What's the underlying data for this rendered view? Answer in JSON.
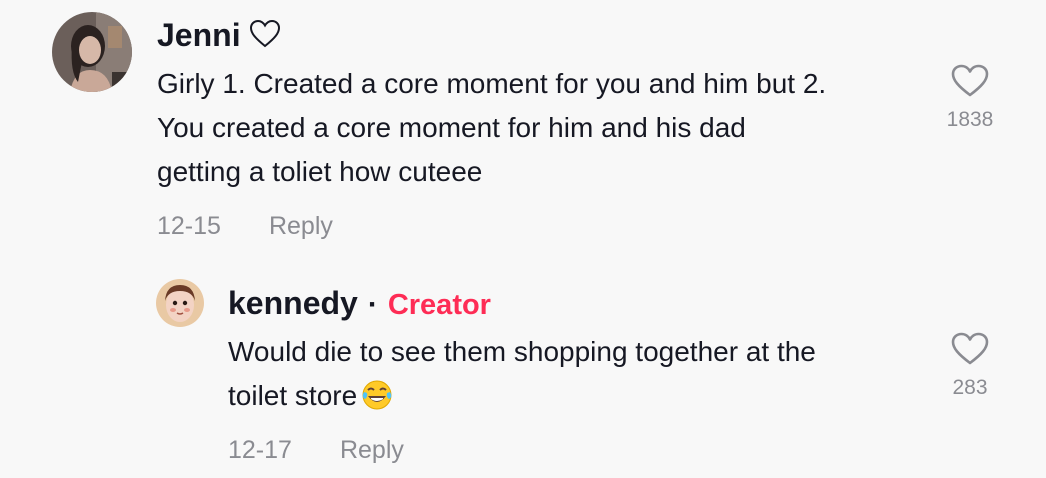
{
  "comment": {
    "username": "Jenni",
    "username_suffix_icon": "heart-outline-icon",
    "text_lines": [
      "Girly 1. Created a core moment for you and him but 2.",
      "You created a core moment for him and his dad",
      "getting a toliet how cuteee"
    ],
    "date": "12-15",
    "reply_label": "Reply",
    "like_icon": "heart-outline-icon",
    "like_count": "1838"
  },
  "reply": {
    "username": "kennedy",
    "separator": "·",
    "badge": "Creator",
    "text_lines": [
      "Would die to see them shopping together at the",
      "toilet store"
    ],
    "emoji": "face-with-tears-of-joy",
    "date": "12-17",
    "reply_label": "Reply",
    "like_icon": "heart-outline-icon",
    "like_count": "283"
  },
  "colors": {
    "background": "#f8f8f8",
    "text": "#161823",
    "muted": "#8a8b91",
    "creator_accent": "#fe2c55"
  }
}
